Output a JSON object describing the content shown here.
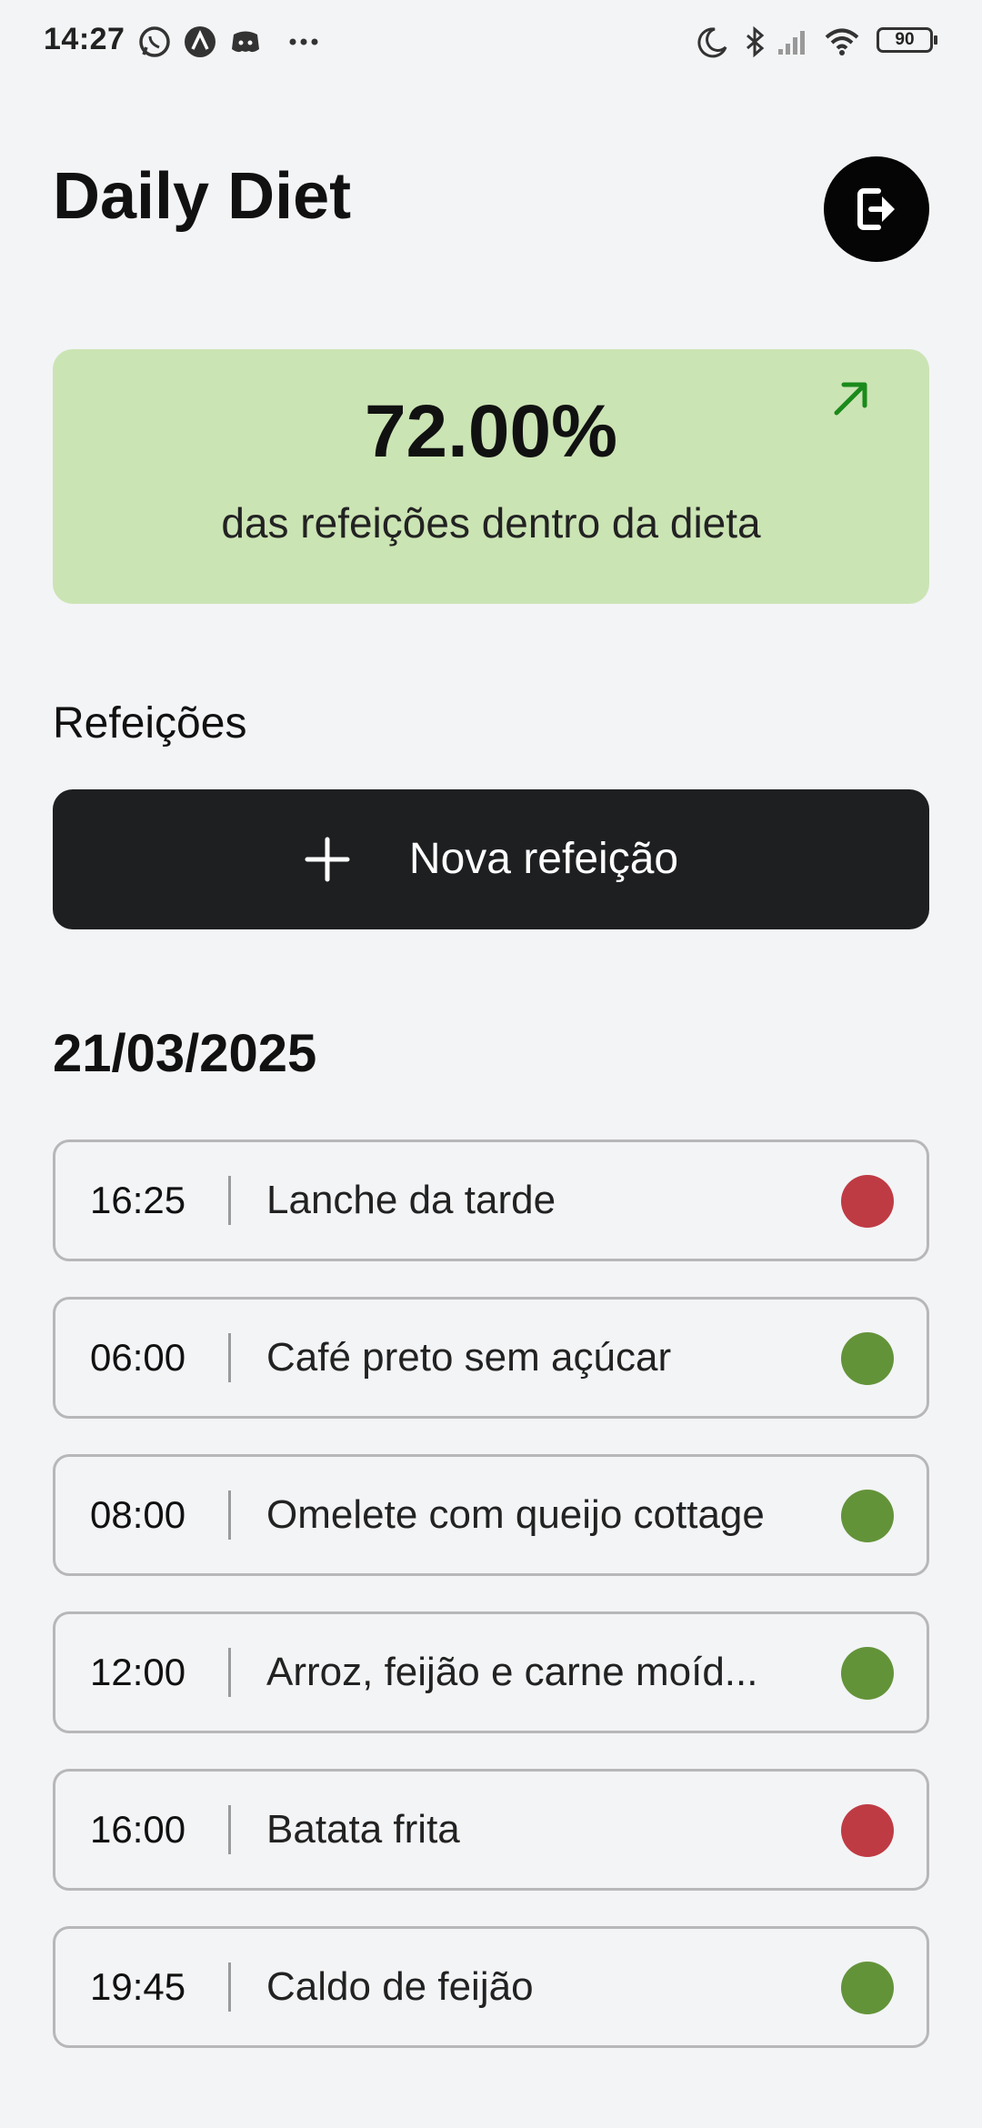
{
  "status_bar": {
    "time": "14:27",
    "battery": "90",
    "notification_icons": [
      "whatsapp-icon",
      "app-a-icon",
      "discord-icon",
      "more-dots-icon"
    ],
    "system_icons": [
      "moon-icon",
      "bluetooth-icon",
      "signal-icon",
      "wifi-icon",
      "battery-icon"
    ]
  },
  "header": {
    "title": "Daily Diet",
    "logout_icon": "logout-icon"
  },
  "stats": {
    "percent": "72.00%",
    "label": "das refeições dentro da dieta",
    "arrow_icon": "arrow-up-right-icon",
    "card_color": "#cbe4b4",
    "arrow_color": "#1a8a1a"
  },
  "meals_section": {
    "title": "Refeições",
    "new_button_label": "Nova refeição",
    "new_button_icon": "plus-icon"
  },
  "day": {
    "date": "21/03/2025",
    "meals": [
      {
        "time": "16:25",
        "name": "Lanche da tarde",
        "in_diet": false
      },
      {
        "time": "06:00",
        "name": "Café preto sem açúcar",
        "in_diet": true
      },
      {
        "time": "08:00",
        "name": "Omelete com queijo cottage",
        "in_diet": true
      },
      {
        "time": "12:00",
        "name": "Arroz, feijão e carne moíd...",
        "in_diet": true
      },
      {
        "time": "16:00",
        "name": "Batata frita",
        "in_diet": false
      },
      {
        "time": "19:45",
        "name": "Caldo de feijão",
        "in_diet": true
      }
    ]
  },
  "colors": {
    "in_diet": "#639339",
    "off_diet": "#bf3b44",
    "background": "#f3f4f6",
    "button_dark": "#1e1f21"
  }
}
